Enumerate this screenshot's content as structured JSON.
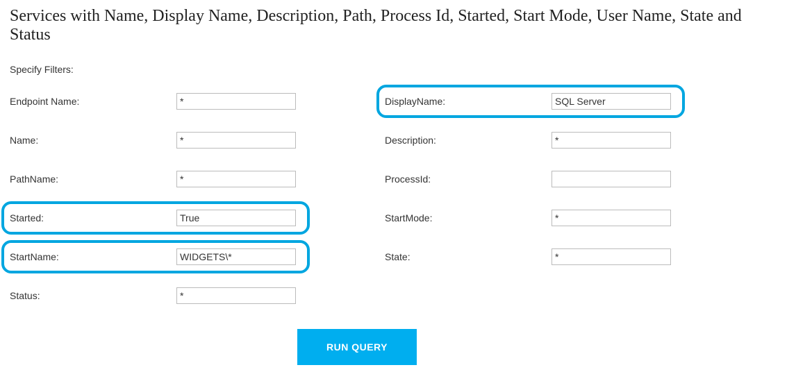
{
  "title": "Services with Name, Display Name, Description, Path, Process Id, Started, Start Mode, User Name, State and Status",
  "subtitle": "Specify Filters:",
  "fields": {
    "endpoint_name": {
      "label": "Endpoint Name:",
      "value": "*"
    },
    "display_name": {
      "label": "DisplayName:",
      "value": "SQL Server"
    },
    "name": {
      "label": "Name:",
      "value": "*"
    },
    "description": {
      "label": "Description:",
      "value": "*"
    },
    "path_name": {
      "label": "PathName:",
      "value": "*"
    },
    "process_id": {
      "label": "ProcessId:",
      "value": ""
    },
    "started": {
      "label": "Started:",
      "value": "True"
    },
    "start_mode": {
      "label": "StartMode:",
      "value": "*"
    },
    "start_name": {
      "label": "StartName:",
      "value": "WIDGETS\\*"
    },
    "state": {
      "label": "State:",
      "value": "*"
    },
    "status": {
      "label": "Status:",
      "value": "*"
    }
  },
  "button": {
    "run_query": "RUN QUERY"
  }
}
